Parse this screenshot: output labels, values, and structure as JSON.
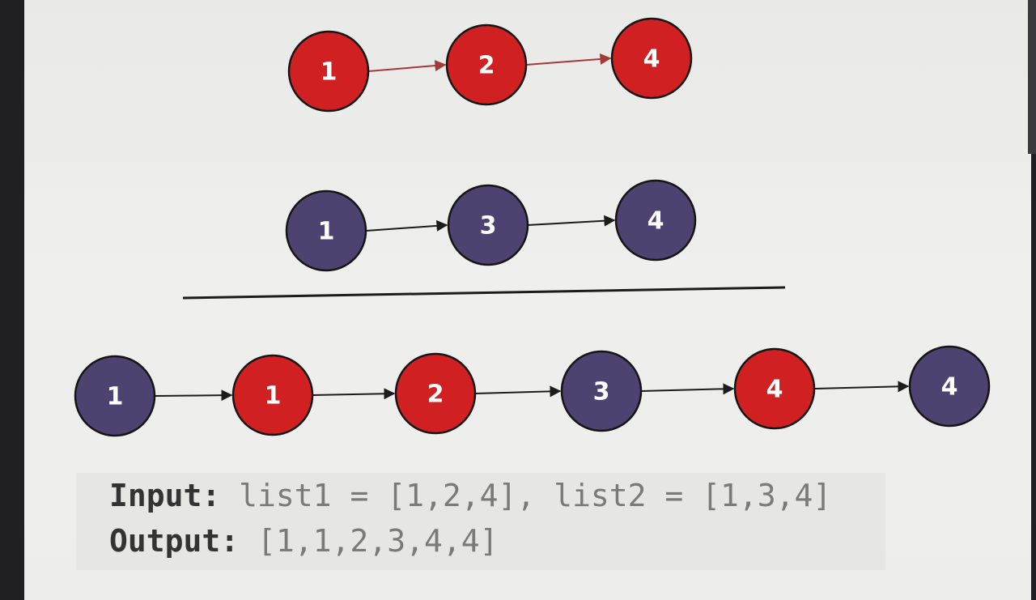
{
  "colors": {
    "list1_node": "#d12022",
    "list2_node": "#4d4270",
    "node_stroke": "#151515",
    "list1_arrow": "#a33a3a",
    "arrow": "#1c1c1c",
    "divider": "#1c1c1c"
  },
  "list1": {
    "nodes": [
      {
        "value": "1",
        "list": "list1"
      },
      {
        "value": "2",
        "list": "list1"
      },
      {
        "value": "4",
        "list": "list1"
      }
    ]
  },
  "list2": {
    "nodes": [
      {
        "value": "1",
        "list": "list2"
      },
      {
        "value": "3",
        "list": "list2"
      },
      {
        "value": "4",
        "list": "list2"
      }
    ]
  },
  "merged": {
    "nodes": [
      {
        "value": "1",
        "list": "list2"
      },
      {
        "value": "1",
        "list": "list1"
      },
      {
        "value": "2",
        "list": "list1"
      },
      {
        "value": "3",
        "list": "list2"
      },
      {
        "value": "4",
        "list": "list1"
      },
      {
        "value": "4",
        "list": "list2"
      }
    ]
  },
  "example": {
    "input_label": "Input:",
    "input_value": "list1 = [1,2,4], list2 = [1,3,4]",
    "output_label": "Output:",
    "output_value": "[1,1,2,3,4,4]"
  }
}
